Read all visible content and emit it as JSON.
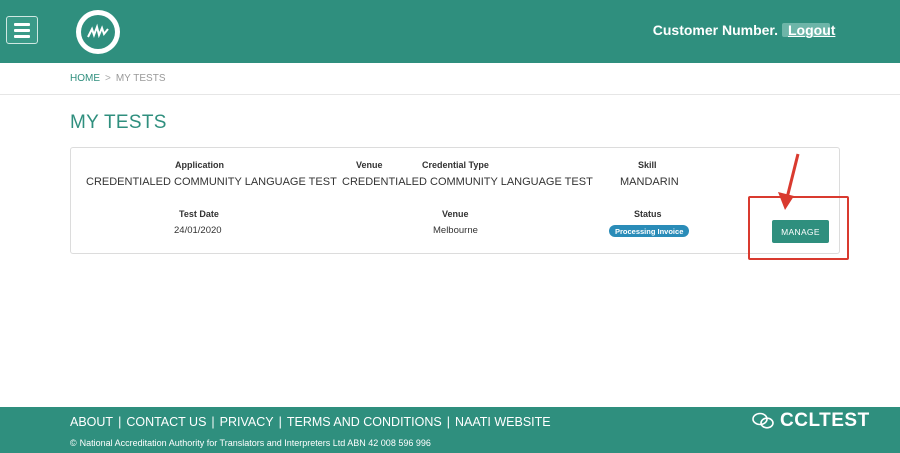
{
  "header": {
    "customer_label": "Customer Number.",
    "logout_label": "Logout"
  },
  "breadcrumb": {
    "home": "HOME",
    "separator": ">",
    "current": "MY TESTS"
  },
  "page_title": "MY TESTS",
  "test_card": {
    "application_label": "Application",
    "application_value": "CREDENTIALED COMMUNITY LANGUAGE TEST",
    "venue_label": "Venue",
    "credential_type_label": "Credential Type",
    "credential_type_value": "CREDENTIALED COMMUNITY LANGUAGE TEST",
    "skill_label": "Skill",
    "skill_value": "MANDARIN",
    "test_date_label": "Test Date",
    "test_date_value": "24/01/2020",
    "venue2_label": "Venue",
    "venue2_value": "Melbourne",
    "status_label": "Status",
    "status_value": "Processing Invoice",
    "manage_label": "MANAGE"
  },
  "colors": {
    "brand": "#2f8f7e",
    "status_badge": "#2a8cb8",
    "highlight": "#d93a2f"
  },
  "footer": {
    "links": [
      "ABOUT",
      "CONTACT US",
      "PRIVACY",
      "TERMS AND CONDITIONS",
      "NAATI WEBSITE"
    ],
    "separator": "|",
    "copyright_symbol": "©",
    "copyright": "National Accreditation Authority for Translators and Interpreters Ltd ABN 42 008 596 996",
    "watermark": "CCLTEST"
  }
}
